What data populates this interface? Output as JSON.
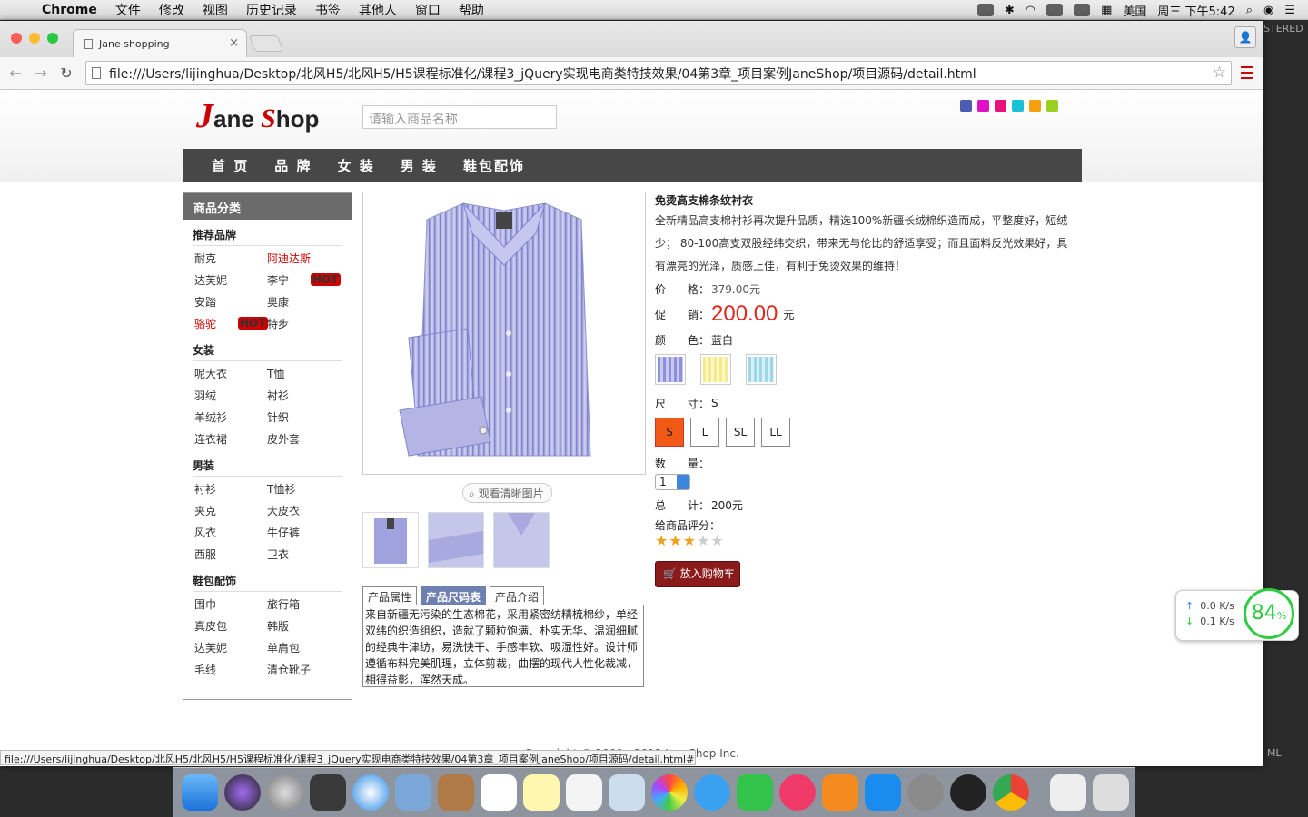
{
  "menubar": {
    "app": "Chrome",
    "items": [
      "文件",
      "修改",
      "视图",
      "历史记录",
      "书签",
      "其他人",
      "窗口",
      "帮助"
    ],
    "input_method": "美国",
    "clock": "周三 下午5:42"
  },
  "browser": {
    "tab_title": "Jane shopping",
    "url": "file:///Users/lijinghua/Desktop/北风H5/北风H5/H5课程标准化/课程3_jQuery实现电商类特技效果/04第3章_项目案例JaneShop/项目源码/detail.html",
    "status_url": "file:///Users/lijinghua/Desktop/北风H5/北风H5/H5课程标准化/课程3_jQuery实现电商类特技效果/04第3章_项目案例JaneShop/项目源码/detail.html#"
  },
  "site": {
    "logo_j": "J",
    "logo_ane": "ane",
    "logo_s": "S",
    "logo_hop": "hop",
    "search_placeholder": "请输入商品名称",
    "nav": [
      "首 页",
      "品 牌",
      "女 装",
      "男 装",
      "鞋包配饰"
    ],
    "skin_colors": [
      "#4a5db0",
      "#e010c8",
      "#e8107a",
      "#18c0d8",
      "#f4a010",
      "#9ad020"
    ]
  },
  "sidebar": {
    "title": "商品分类",
    "hot_badge": "HOT",
    "groups": [
      {
        "title": "推荐品牌",
        "items": [
          "耐克",
          "阿迪达斯",
          "达芙妮",
          "李宁",
          "安踏",
          "奥康",
          "骆驼",
          "特步"
        ]
      },
      {
        "title": "女装",
        "items": [
          "呢大衣",
          "T恤",
          "羽绒",
          "衬衫",
          "羊绒衫",
          "针织",
          "连衣裙",
          "皮外套"
        ]
      },
      {
        "title": "男装",
        "items": [
          "衬衫",
          "T恤衫",
          "夹克",
          "大皮衣",
          "风衣",
          "牛仔裤",
          "西服",
          "卫衣"
        ]
      },
      {
        "title": "鞋包配饰",
        "items": [
          "围巾",
          "旅行箱",
          "真皮包",
          "韩版",
          "达芙妮",
          "单肩包",
          "毛线",
          "清仓靴子"
        ]
      }
    ]
  },
  "gallery": {
    "zoom_label": "观看清晰图片",
    "tabs": [
      "产品属性",
      "产品尺码表",
      "产品介绍"
    ],
    "active_tab": 1,
    "tab_content": "来自新疆无污染的生态棉花，采用紧密纺精梳棉纱，单经双纬的织造组织，造就了颗粒饱满、朴实无华、温润细腻的经典牛津纺，易洗快干、手感丰软、吸湿性好。设计师遵循布料完美肌理，立体剪裁，曲摆的现代人性化裁减，相得益彰，浑然天成。"
  },
  "product": {
    "title": "免烫高支棉条纹衬衣",
    "description": "全新精品高支棉衬衫再次提升品质，精选100%新疆长绒棉织造而成，平整度好，短绒少； 80-100高支双股经纬交织，带来无与伦比的舒适享受；而且面料反光效果好，具有漂亮的光泽，质感上佳，有利于免烫效果的维持！",
    "price_label": "价　　格：",
    "price_old": "379.00元",
    "promo_label": "促　　销：",
    "promo_price": "200.00",
    "promo_unit": "元",
    "color_label": "颜　　色：",
    "color_value": "蓝白",
    "size_label": "尺　　寸：",
    "size_value": "S",
    "sizes": [
      "S",
      "L",
      "SL",
      "LL"
    ],
    "qty_label": "数　　量：",
    "qty_value": "1",
    "total_label": "总　　计：",
    "total_value": "200元",
    "rating_label": "给商品评分：",
    "rating": 3,
    "rating_max": 5,
    "cart_button": "放入购物车"
  },
  "footer": {
    "copyright": "Copyright © 2009 - 2012 JaneShop Inc."
  },
  "netspeed": {
    "up": "0.0 K/s",
    "down": "0.1 K/s",
    "percent": "84",
    "percent_unit": "%"
  },
  "right_panel": {
    "top_text": "STERED",
    "bottom_text": "ML"
  }
}
